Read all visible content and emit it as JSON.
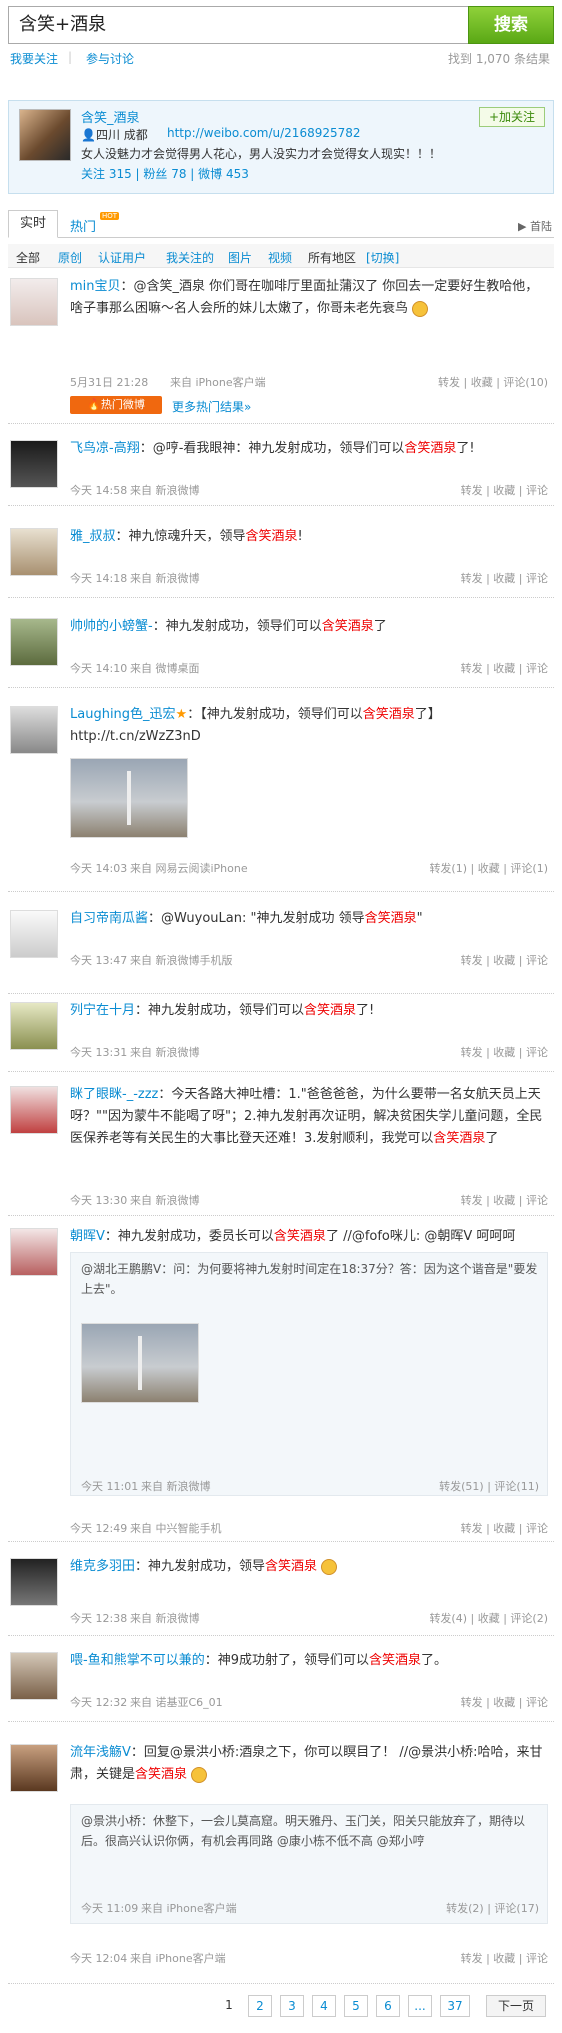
{
  "search": {
    "query": "含笑+酒泉",
    "button": "搜索"
  },
  "subnav": {
    "follow": "我要关注",
    "discuss": "参与讨论",
    "result": "找到 1,070 条结果"
  },
  "profile": {
    "name": "含笑_酒泉",
    "location": "四川  成都",
    "url": "http://weibo.com/u/2168925782",
    "desc": "女人没魅力才会觉得男人花心，男人没实力才会觉得女人现实！！！",
    "stats": "关注 315 | 粉丝 78 | 微博 453",
    "follow": "+加关注"
  },
  "tabs": {
    "realtime": "实时",
    "hot": "热门",
    "hot_badge": "HOT",
    "home": "首陆"
  },
  "filter": {
    "all": "全部",
    "orig": "原创",
    "verified": "认证用户",
    "following": "我关注的",
    "pics": "图片",
    "videos": "视频",
    "region": "所有地区",
    "switch": "[切换]"
  },
  "posts": [
    {
      "user": "min宝贝",
      "text": "：@含笑_酒泉 你们哥在咖啡厅里面扯蒲汉了 你回去一定要好生教哈他，啥子事那么困嘛～名人会所的妹儿太嫩了，你哥未老先衰鸟",
      "time": "5月31日 21:28",
      "src": "来自 iPhone客户端",
      "acts": "转发 | 收藏 | 评论(10)",
      "hot": "热门微博",
      "more": "更多热门结果»"
    },
    {
      "user": "飞鸟凉-高翔",
      "text": "：@哼-看我眼神：神九发射成功，领导们可以含笑酒泉了!",
      "time": "今天 14:58",
      "src": "来自 新浪微博",
      "acts": "转发 | 收藏 | 评论"
    },
    {
      "user": "雅_叔叔",
      "text": "：神九惊魂升天，领导含笑酒泉!",
      "time": "今天 14:18",
      "src": "来自 新浪微博",
      "acts": "转发 | 收藏 | 评论"
    },
    {
      "user": "帅帅的小螃蟹-",
      "text": "：神九发射成功，领导们可以含笑酒泉了",
      "time": "今天 14:10",
      "src": "来自 微博桌面",
      "acts": "转发 | 收藏 | 评论"
    },
    {
      "user": "Laughing色_迅宏",
      "text": "：【神九发射成功，领导们可以含笑酒泉了】 http://t.cn/zWzZ3nD",
      "time": "今天 14:03",
      "src": "来自 网易云阅读iPhone",
      "acts": "转发(1) | 收藏 | 评论(1)"
    },
    {
      "user": "自习帝南瓜酱",
      "text": "：@WuyouLan: \"神九发射成功 领导含笑酒泉\"",
      "time": "今天 13:47",
      "src": "来自 新浪微博手机版",
      "acts": "转发 | 收藏 | 评论"
    },
    {
      "user": "列宁在十月",
      "text": "：神九发射成功，领导们可以含笑酒泉了!",
      "time": "今天 13:31",
      "src": "来自 新浪微博",
      "acts": "转发 | 收藏 | 评论"
    },
    {
      "user": "眯了眼眯-_-zzz",
      "text": "：今天各路大神吐槽：1.\"爸爸爸爸，为什么要带一名女航天员上天呀？\"\"因为蒙牛不能喝了呀\"；2.神九发射再次证明，解决贫困失学儿童问题，全民医保养老等有关民生的大事比登天还难！3.发射顺利，我党可以含笑酒泉了",
      "time": "今天 13:30",
      "src": "来自 新浪微博",
      "acts": "转发 | 收藏 | 评论"
    },
    {
      "user": "朝晖V",
      "text": "：神九发射成功，委员长可以含笑酒泉了 //@fofo咪儿: @朝晖V 呵呵呵",
      "quote": "@湖北王鹏鹏V：问：为何要将神九发射时间定在18:37分？答：因为这个谐音是\"要发上去\"。",
      "qtime": "今天 11:01",
      "qsrc": "来自 新浪微博",
      "qacts": "转发(51) | 评论(11)",
      "time": "今天 12:49",
      "src": "来自 中兴智能手机",
      "acts": "转发 | 收藏 | 评论"
    },
    {
      "user": "维克多羽田",
      "text": "：神九发射成功，领导含笑酒泉",
      "time": "今天 12:38",
      "src": "来自 新浪微博",
      "acts": "转发(4) | 收藏 | 评论(2)"
    },
    {
      "user": "喂-鱼和熊掌不可以兼的",
      "text": "：神9成功射了，领导们可以含笑酒泉了。",
      "time": "今天 12:32",
      "src": "来自 诺基亚C6_01",
      "acts": "转发 | 收藏 | 评论"
    },
    {
      "user": "流年浅觞V",
      "text": "：回复@景洪小桥:酒泉之下，你可以瞑目了！ //@景洪小桥:哈哈，来甘肃，关键是含笑酒泉",
      "quote": "@景洪小桥：休整下，一会儿莫高窟。明天雅丹、玉门关，阳关只能放弃了，期待以后。很高兴认识你俩，有机会再同路 @康小栋不低不高 @郑小哼",
      "qtime": "今天 11:09",
      "qsrc": "来自 iPhone客户端",
      "qacts": "转发(2) | 评论(17)",
      "time": "今天 12:04",
      "src": "来自 iPhone客户端",
      "acts": "转发 | 收藏 | 评论"
    }
  ],
  "pager": {
    "p1": "1",
    "p2": "2",
    "p3": "3",
    "p4": "4",
    "p5": "5",
    "p6": "6",
    "dots": "...",
    "last": "37",
    "next": "下一页"
  }
}
